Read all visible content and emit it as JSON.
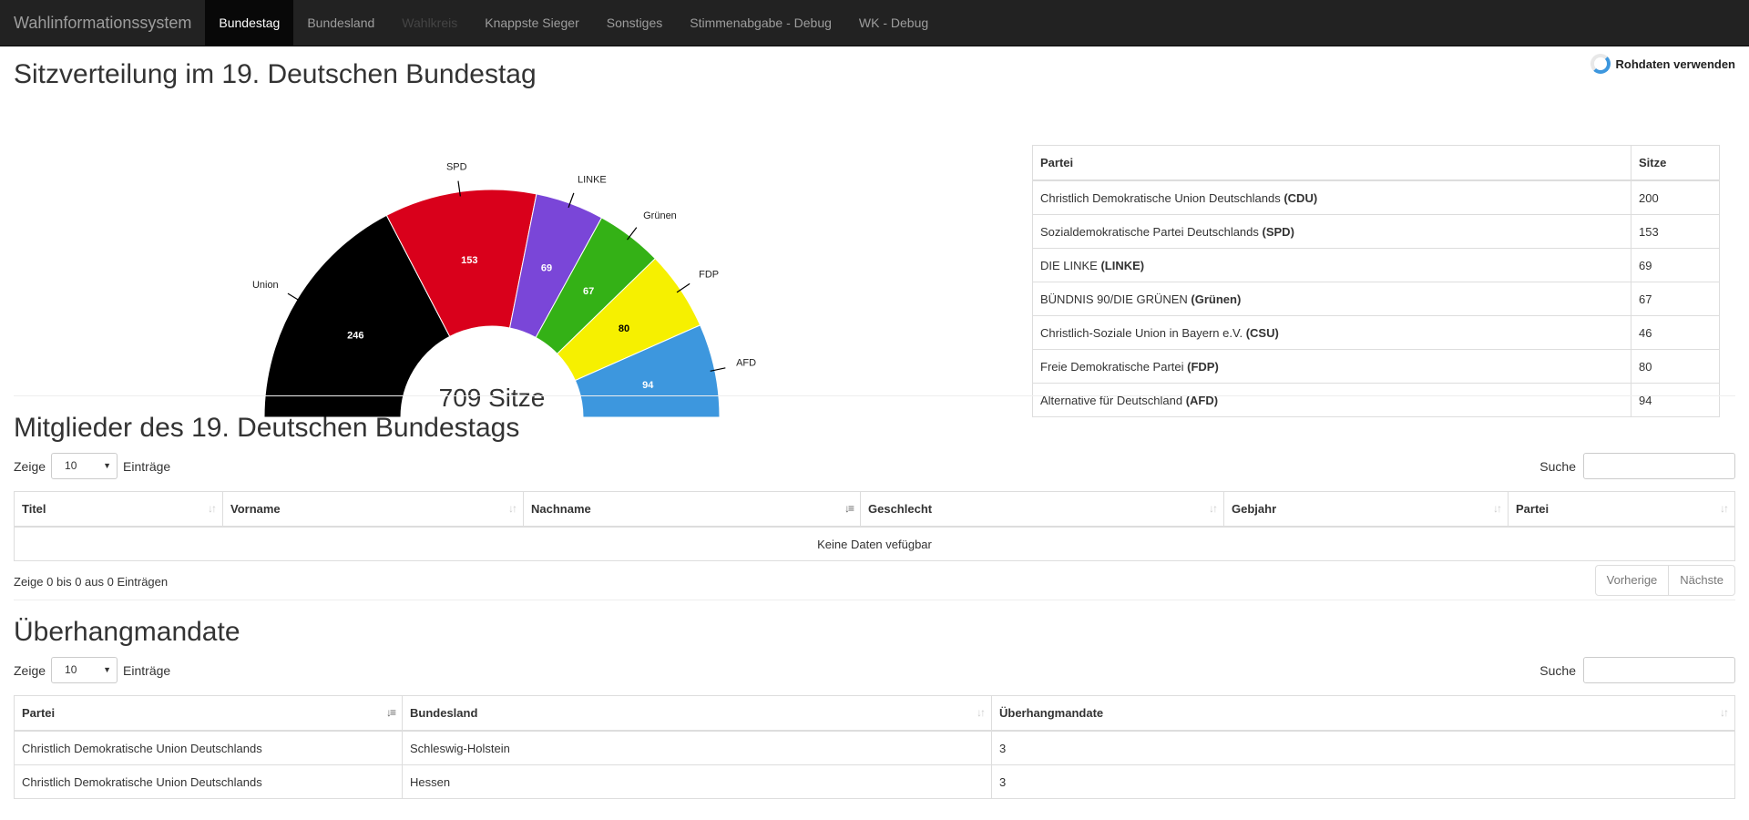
{
  "navbar": {
    "brand": "Wahlinformationssystem",
    "items": [
      {
        "label": "Bundestag",
        "state": "active"
      },
      {
        "label": "Bundesland",
        "state": "normal"
      },
      {
        "label": "Wahlkreis",
        "state": "disabled"
      },
      {
        "label": "Knappste Sieger",
        "state": "normal"
      },
      {
        "label": "Sonstiges",
        "state": "normal"
      },
      {
        "label": "Stimmenabgabe - Debug",
        "state": "normal"
      },
      {
        "label": "WK - Debug",
        "state": "normal"
      }
    ]
  },
  "seats": {
    "title": "Sitzverteilung im 19. Deutschen Bundestag",
    "raw_toggle_label": "Rohdaten verwenden",
    "table_headers": [
      "Partei",
      "Sitze"
    ],
    "rows": [
      {
        "name": "Christlich Demokratische Union Deutschlands ",
        "abbr": "(CDU)",
        "seats": "200"
      },
      {
        "name": "Sozialdemokratische Partei Deutschlands ",
        "abbr": "(SPD)",
        "seats": "153"
      },
      {
        "name": "DIE LINKE ",
        "abbr": "(LINKE)",
        "seats": "69"
      },
      {
        "name": "BÜNDNIS 90/DIE GRÜNEN ",
        "abbr": "(Grünen)",
        "seats": "67"
      },
      {
        "name": "Christlich-Soziale Union in Bayern e.V. ",
        "abbr": "(CSU)",
        "seats": "46"
      },
      {
        "name": "Freie Demokratische Partei ",
        "abbr": "(FDP)",
        "seats": "80"
      },
      {
        "name": "Alternative für Deutschland ",
        "abbr": "(AFD)",
        "seats": "94"
      }
    ]
  },
  "chart_data": {
    "type": "pie",
    "variant": "half-donut",
    "center_label": "709 Sitze",
    "categories": [
      "Union",
      "SPD",
      "LINKE",
      "Grünen",
      "FDP",
      "AFD"
    ],
    "values": [
      246,
      153,
      69,
      67,
      80,
      94
    ],
    "colors": [
      "#000000",
      "#d9001b",
      "#7a46d8",
      "#34b116",
      "#f6f000",
      "#3d97de"
    ],
    "value_label_colors": [
      "#ffffff",
      "#ffffff",
      "#ffffff",
      "#ffffff",
      "#000000",
      "#ffffff"
    ]
  },
  "members": {
    "title": "Mitglieder des 19. Deutschen Bundestags",
    "length_prefix": "Zeige",
    "length_value": "10",
    "length_suffix": "Einträge",
    "search_label": "Suche",
    "headers": [
      "Titel",
      "Vorname",
      "Nachname",
      "Geschlecht",
      "Gebjahr",
      "Partei"
    ],
    "sorted_column": "Nachname",
    "empty_text": "Keine Daten vefügbar",
    "info": "Zeige 0 bis 0 aus 0 Einträgen",
    "prev": "Vorherige",
    "next": "Nächste"
  },
  "overhang": {
    "title": "Überhangmandate",
    "length_prefix": "Zeige",
    "length_value": "10",
    "length_suffix": "Einträge",
    "search_label": "Suche",
    "headers": [
      "Partei",
      "Bundesland",
      "Überhangmandate"
    ],
    "sorted_column": "Partei",
    "rows": [
      [
        "Christlich Demokratische Union Deutschlands",
        "Schleswig-Holstein",
        "3"
      ],
      [
        "Christlich Demokratische Union Deutschlands",
        "Hessen",
        "3"
      ]
    ]
  }
}
